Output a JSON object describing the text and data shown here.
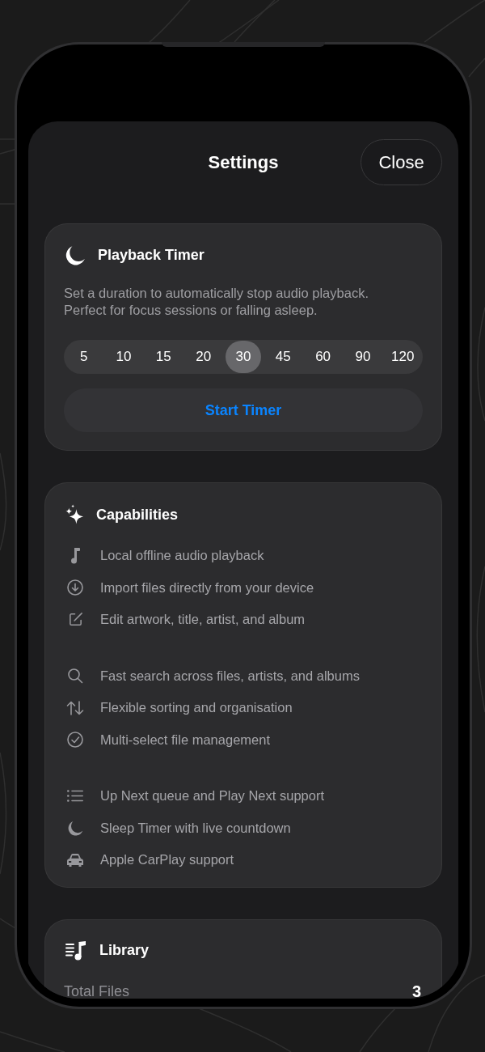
{
  "header": {
    "title": "Settings",
    "close_label": "Close"
  },
  "timer": {
    "title": "Playback Timer",
    "description": "Set a duration to automatically stop audio playback. Perfect for focus sessions or falling asleep.",
    "durations": [
      {
        "label": "5",
        "selected": false
      },
      {
        "label": "10",
        "selected": false
      },
      {
        "label": "15",
        "selected": false
      },
      {
        "label": "20",
        "selected": false
      },
      {
        "label": "30",
        "selected": true
      },
      {
        "label": "45",
        "selected": false
      },
      {
        "label": "60",
        "selected": false
      },
      {
        "label": "90",
        "selected": false
      },
      {
        "label": "120",
        "selected": false
      }
    ],
    "start_button": "Start Timer"
  },
  "capabilities": {
    "title": "Capabilities",
    "groups": [
      [
        "Local offline audio playback",
        "Import files directly from your device",
        "Edit artwork, title, artist, and album"
      ],
      [
        "Fast search across files, artists, and albums",
        "Flexible sorting and organisation",
        "Multi-select file management"
      ],
      [
        "Up Next queue and Play Next support",
        "Sleep Timer with live countdown",
        "Apple CarPlay support"
      ]
    ]
  },
  "library": {
    "title": "Library",
    "stats": [
      {
        "label": "Total Files",
        "value": "3"
      }
    ]
  }
}
